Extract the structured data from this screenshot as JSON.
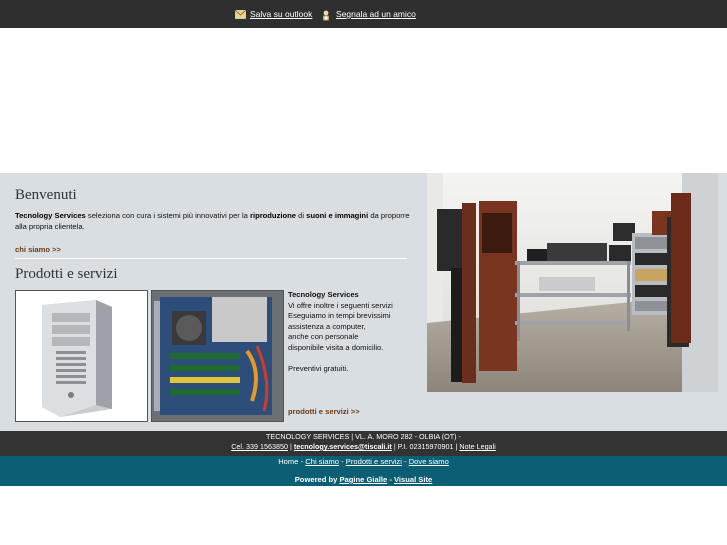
{
  "topbar": {
    "save_outlook": "Salva su outlook",
    "report_friend": "Segnala ad un amico"
  },
  "welcome": {
    "title": "Benvenuti",
    "brand": "Tecnology Services",
    "text_1": "seleziona con cura i sistemi più innovativi per la",
    "bold_1": "riproduzione",
    "text_2": "di",
    "bold_2": "suoni e immagini",
    "text_3": "da proporre alla propria clientela.",
    "more_label": "chi siamo",
    "more_arrow": ">>"
  },
  "products": {
    "title": "Prodotti e servizi",
    "box_title": "Tecnology Services",
    "lines": [
      "Vi offre inoltre i seguenti servizi",
      "Eseguiamo in tempi brevissimi",
      "assistenza a computer,",
      "anche con personale",
      "disponibile visita a domicilio.",
      "",
      "Preventivi gratuiti."
    ],
    "more_label": "prodotti e servizi",
    "more_arrow": ">>"
  },
  "footer": {
    "address": "TECNOLOGY SERVICES | VL. A. MORO 282 - OLBIA (OT) -",
    "phone": "Cel. 339 1563850",
    "sep1": "|",
    "email": "tecnology.services@tiscali.it",
    "sep2": "| P.I. 02315970901 |",
    "legal": "Note Legali"
  },
  "nav": {
    "home": "Home",
    "chi_siamo": "Chi siamo",
    "prodotti": "Prodotti e servizi",
    "dove": "Dove siamo",
    "sep": "-",
    "powered": "Powered by",
    "pagine_gialle": "Pagine Gialle",
    "dash": "-",
    "visual_site": "Visual Site"
  },
  "colors": {
    "topbar": "#2f2f2f",
    "band": "#d9dee3",
    "link_brown": "#6b3a10",
    "footer_dark": "#333333",
    "footer_teal": "#0b5e73"
  },
  "icons": [
    "outlook-icon",
    "friend-icon",
    "pc-case-image",
    "pc-interior-image",
    "hifi-photo"
  ]
}
